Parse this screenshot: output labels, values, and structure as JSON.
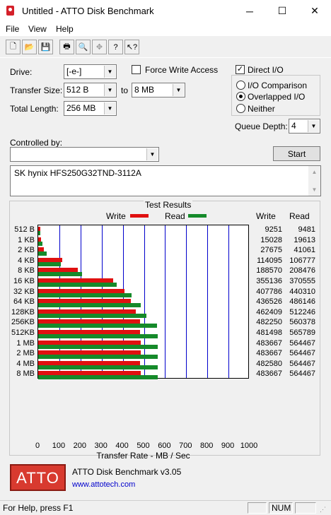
{
  "window": {
    "title": "Untitled - ATTO Disk Benchmark",
    "minimize": "─",
    "maximize": "☐",
    "close": "✕"
  },
  "menu": [
    "File",
    "View",
    "Help"
  ],
  "toolbar": {
    "icons": [
      "new-file-icon",
      "open-folder-icon",
      "save-icon",
      "print-icon",
      "print-preview-icon",
      "move-icon",
      "help-icon",
      "context-help-icon"
    ],
    "glyphs": [
      "🗋",
      "📂",
      "💾",
      "🖶",
      "🔍",
      "✥",
      "?",
      "↖?"
    ]
  },
  "settings": {
    "drive_label": "Drive:",
    "drive_value": "[-e-]",
    "transfer_size_label": "Transfer Size:",
    "transfer_from": "512 B",
    "to_label": "to",
    "transfer_to": "8 MB",
    "total_length_label": "Total Length:",
    "total_length": "256 MB",
    "force_write_label": "Force Write Access",
    "direct_io_label": "Direct I/O",
    "radio_io_comparison": "I/O Comparison",
    "radio_overlapped": "Overlapped I/O",
    "radio_neither": "Neither",
    "queue_depth_label": "Queue Depth:",
    "queue_depth": "4",
    "controlled_by_label": "Controlled by:",
    "controlled_by_value": "",
    "start_label": "Start",
    "description": "SK hynix HFS250G32TND-3112A"
  },
  "results": {
    "title": "Test Results",
    "legend_write": "Write",
    "legend_read": "Read",
    "col_write": "Write",
    "col_read": "Read",
    "xlabel": "Transfer Rate - MB / Sec"
  },
  "chart_data": {
    "type": "bar",
    "title": "Test Results",
    "xlabel": "Transfer Rate - MB / Sec",
    "ylabel": "",
    "xlim": [
      0,
      1000
    ],
    "xticks": [
      0,
      100,
      200,
      300,
      400,
      500,
      600,
      700,
      800,
      900,
      1000
    ],
    "categories": [
      "512 B",
      "1 KB",
      "2 KB",
      "4 KB",
      "8 KB",
      "16 KB",
      "32 KB",
      "64 KB",
      "128KB",
      "256KB",
      "512KB",
      "1 MB",
      "2 MB",
      "4 MB",
      "8 MB"
    ],
    "series": [
      {
        "name": "Write",
        "color": "#e01010",
        "values": [
          9.251,
          15.028,
          27.675,
          114.095,
          188.57,
          355.136,
          407.786,
          436.526,
          462.409,
          482.25,
          481.498,
          483.667,
          483.667,
          482.58,
          483.667
        ],
        "table_values": [
          "9251",
          "15028",
          "27675",
          "114095",
          "188570",
          "355136",
          "407786",
          "436526",
          "462409",
          "482250",
          "481498",
          "483667",
          "483667",
          "482580",
          "483667"
        ]
      },
      {
        "name": "Read",
        "color": "#158a2a",
        "values": [
          9.481,
          19.613,
          41.061,
          106.777,
          208.476,
          370.555,
          440.31,
          486.146,
          512.246,
          560.378,
          565.789,
          564.467,
          564.467,
          564.467,
          564.467
        ],
        "table_values": [
          "9481",
          "19613",
          "41061",
          "106777",
          "208476",
          "370555",
          "440310",
          "486146",
          "512246",
          "560378",
          "565789",
          "564467",
          "564467",
          "564467",
          "564467"
        ]
      }
    ]
  },
  "footer": {
    "logo_text": "ATTO",
    "product": "ATTO Disk Benchmark v3.05",
    "url": "www.attotech.com"
  },
  "status": {
    "help_text": "For Help, press F1",
    "num": "NUM"
  }
}
